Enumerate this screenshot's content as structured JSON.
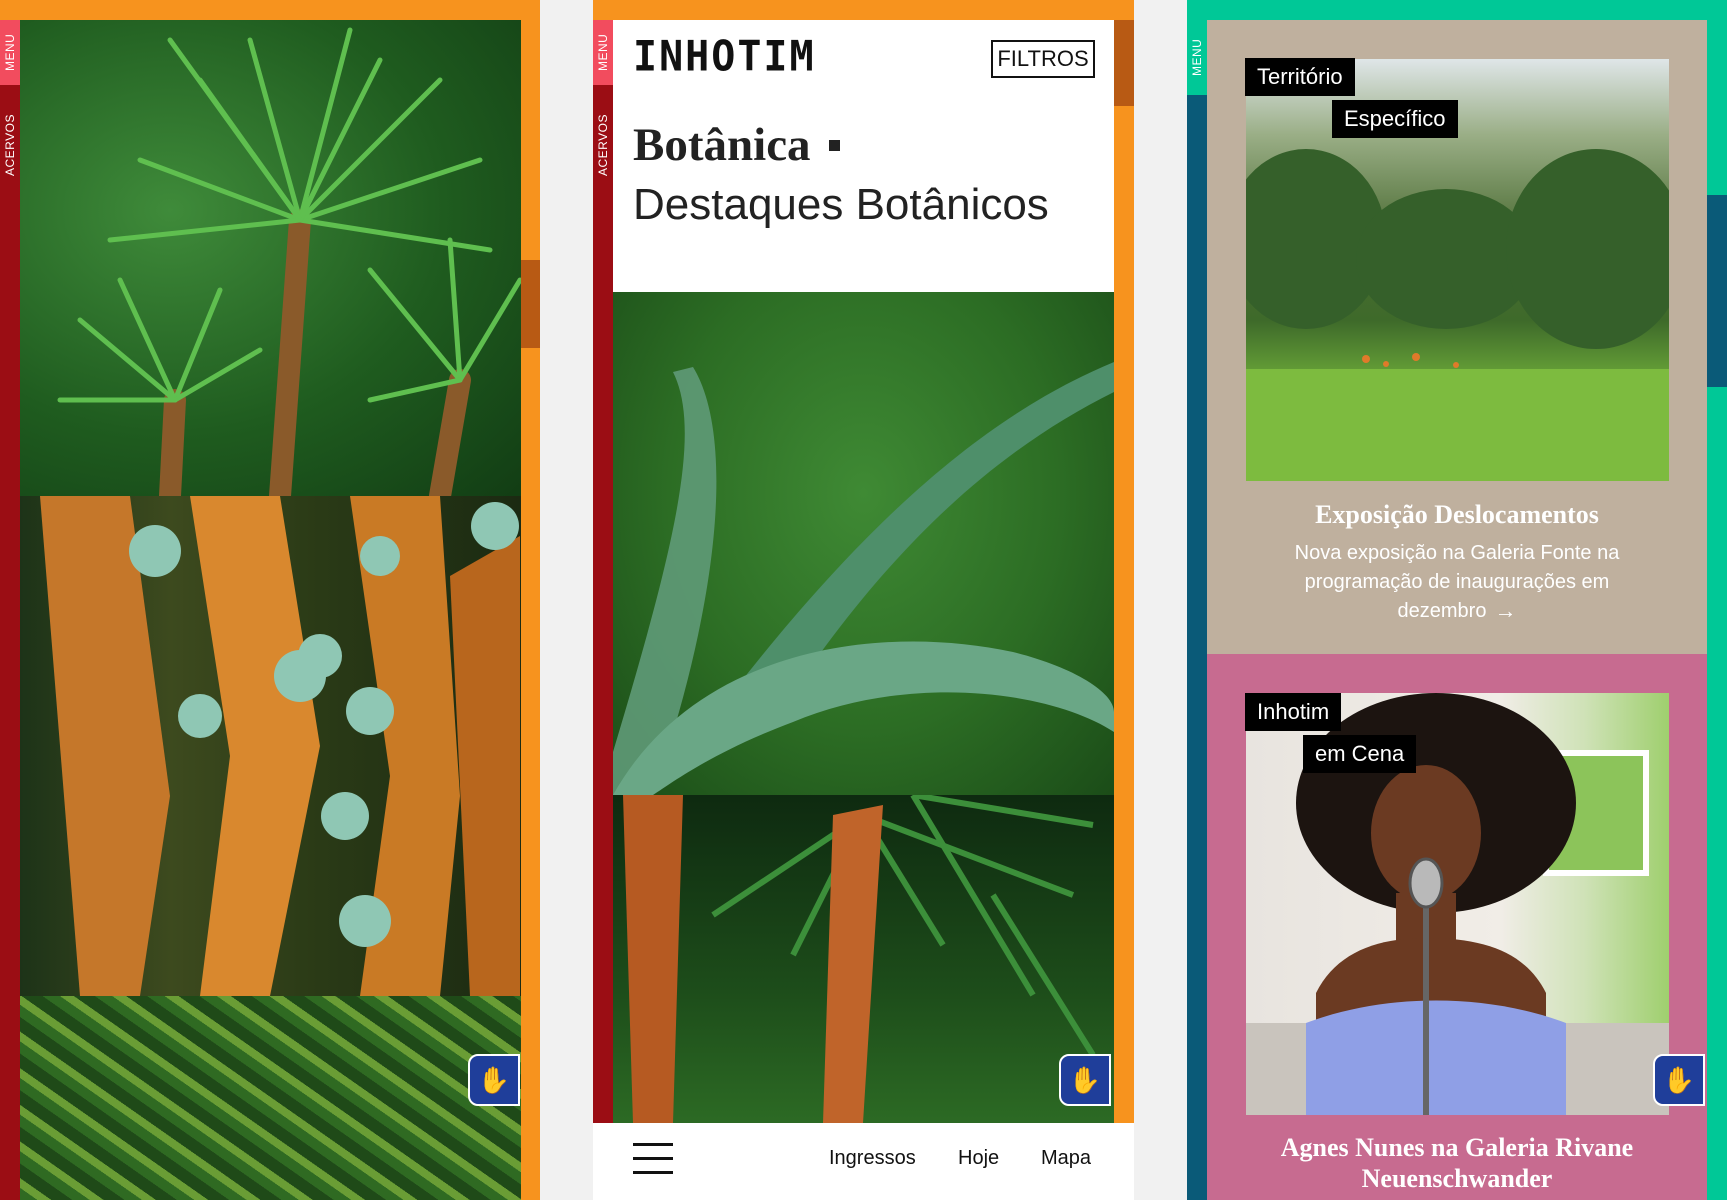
{
  "colors": {
    "orange": "#f7931e",
    "dark_red": "#9b0d14",
    "pink": "#f24c5e",
    "teal": "#00c897",
    "petrol": "#0a5a78",
    "beige": "#bfb09e",
    "rose": "#c76b90",
    "blue": "#1f3e9a"
  },
  "screen1": {
    "menu_label": "MENU",
    "acervos_label": "ACERVOS",
    "accessibility_icon": "sign-language-icon"
  },
  "screen2": {
    "menu_label": "MENU",
    "acervos_label": "ACERVOS",
    "logo": "INHOTIM",
    "filter_button": "FILTROS",
    "title": "Botânica",
    "subtitle": "Destaques Botânicos",
    "bottom_nav": {
      "menu_icon": "hamburger-icon",
      "items": [
        "Ingressos",
        "Hoje",
        "Mapa"
      ]
    },
    "accessibility_icon": "sign-language-icon"
  },
  "screen3": {
    "menu_label": "MENU",
    "card1": {
      "tag1": "Território",
      "tag2": "Específico",
      "title": "Exposição Deslocamentos",
      "description_lines": [
        "Nova exposição na Galeria Fonte na",
        "programação de inaugurações em",
        "dezembro"
      ],
      "arrow_icon": "arrow-right-icon"
    },
    "card2": {
      "tag1": "Inhotim",
      "tag2": "em Cena",
      "title_lines": [
        "Agnes Nunes na Galeria Rivane",
        "Neuenschwander"
      ]
    },
    "accessibility_icon": "sign-language-icon"
  }
}
